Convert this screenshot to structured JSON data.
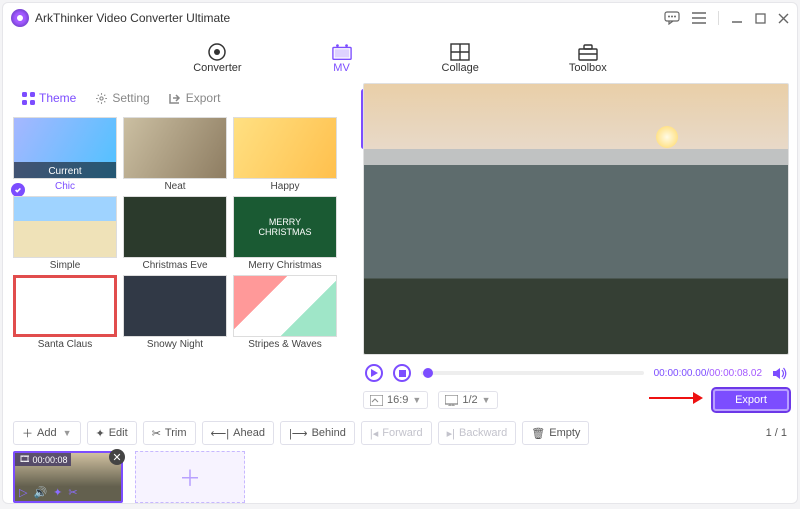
{
  "app_title": "ArkThinker Video Converter Ultimate",
  "topnav": {
    "converter": "Converter",
    "mv": "MV",
    "collage": "Collage",
    "toolbox": "Toolbox"
  },
  "subtabs": {
    "theme": "Theme",
    "setting": "Setting",
    "export": "Export"
  },
  "themes": [
    {
      "label": "Chic",
      "current_label": "Current"
    },
    {
      "label": "Neat"
    },
    {
      "label": "Happy"
    },
    {
      "label": "Simple"
    },
    {
      "label": "Christmas Eve"
    },
    {
      "label": "Merry Christmas",
      "inner": "MERRY\nCHRISTMAS"
    },
    {
      "label": "Santa Claus"
    },
    {
      "label": "Snowy Night"
    },
    {
      "label": "Stripes & Waves"
    }
  ],
  "player": {
    "current": "00:00:00.00",
    "duration": "00:00:08.02",
    "aspect": "16:9",
    "frac": "1/2"
  },
  "export_button": "Export",
  "toolbar": {
    "add": "Add",
    "edit": "Edit",
    "trim": "Trim",
    "ahead": "Ahead",
    "behind": "Behind",
    "forward": "Forward",
    "backward": "Backward",
    "empty": "Empty"
  },
  "page": "1 / 1",
  "clip": {
    "time": "00:00:08"
  },
  "colors": {
    "accent": "#7c4dff"
  }
}
